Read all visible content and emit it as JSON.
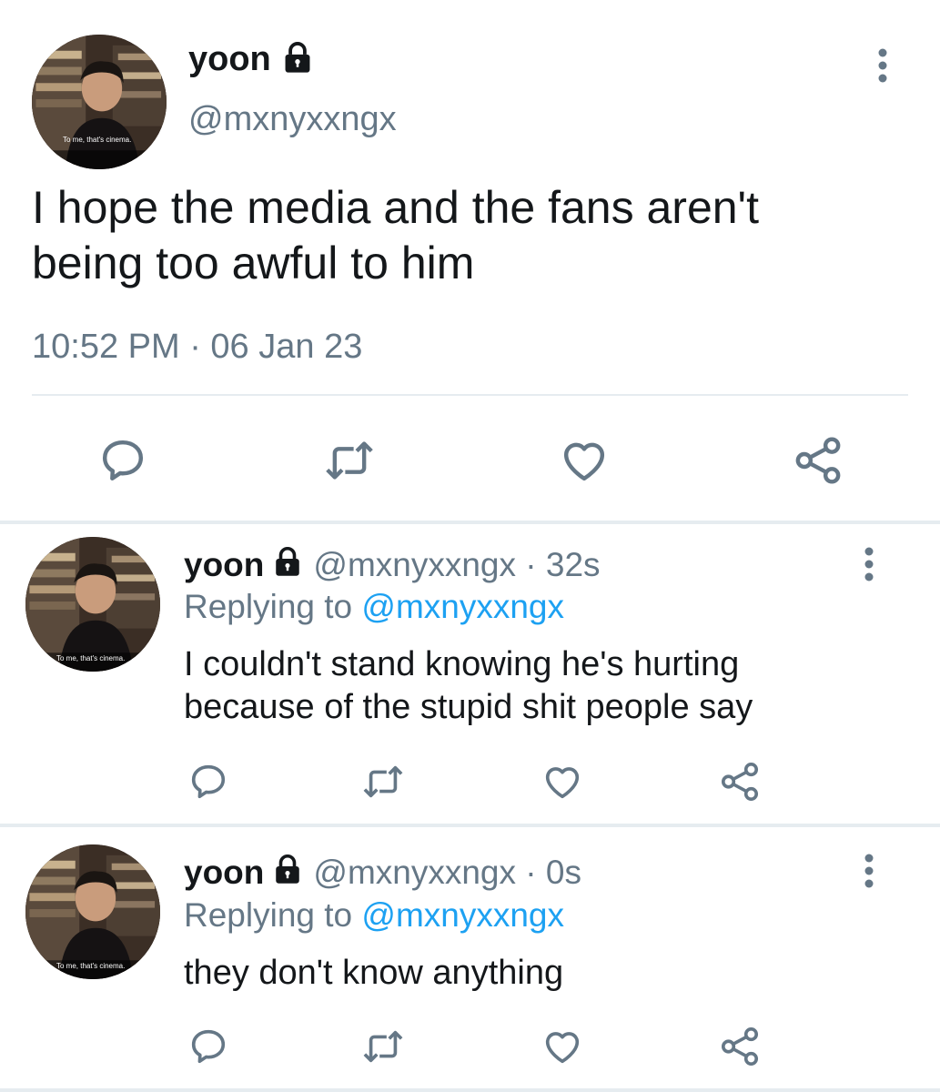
{
  "main_tweet": {
    "display_name": "yoon",
    "handle": "@mxnyxxngx",
    "text_line1": "I hope the media and the fans aren't",
    "text_line2": "being too awful to him",
    "timestamp": "10:52 PM · 06 Jan 23",
    "avatar_caption": "To me, that's cinema."
  },
  "replies": [
    {
      "display_name": "yoon",
      "handle_time": "@mxnyxxngx · 32s",
      "replying_prefix": "Replying to",
      "replying_handle": "@mxnyxxngx",
      "text_line1": "I couldn't stand knowing he's hurting",
      "text_line2": "because of the stupid shit people say",
      "avatar_caption": "To me, that's cinema."
    },
    {
      "display_name": "yoon",
      "handle_time": "@mxnyxxngx · 0s",
      "replying_prefix": "Replying to",
      "replying_handle": "@mxnyxxngx",
      "text_line1": "they don't know anything",
      "avatar_caption": "To me, that's cinema."
    }
  ],
  "colors": {
    "icon": "#657786",
    "link": "#1da1f2",
    "divider": "#e6ecf0"
  },
  "icons": [
    "lock-icon",
    "more-options-icon",
    "reply-icon",
    "retweet-icon",
    "like-icon",
    "share-icon"
  ]
}
